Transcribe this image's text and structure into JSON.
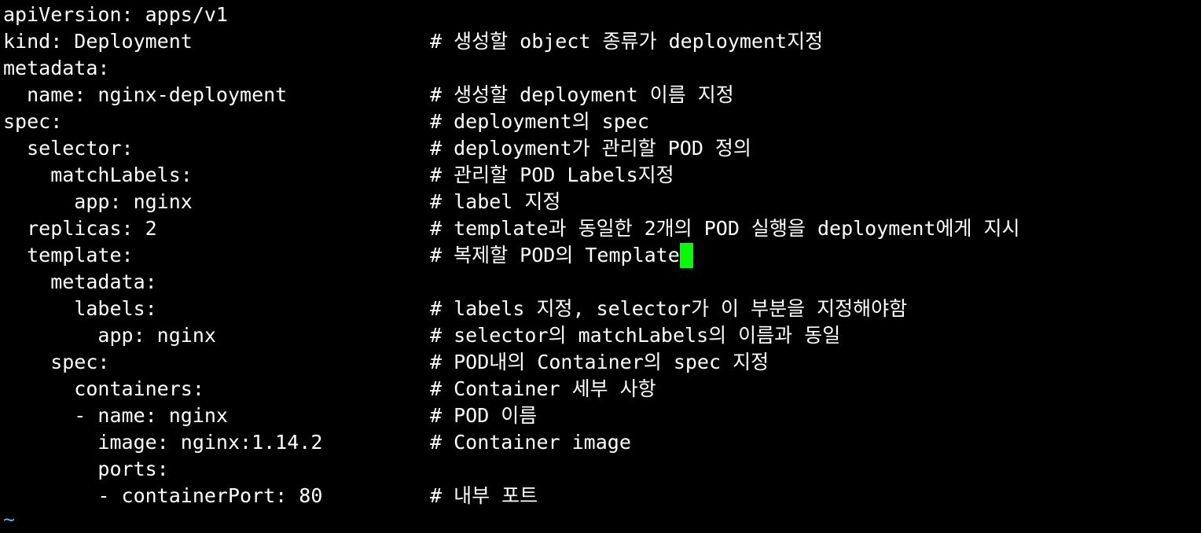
{
  "editor": {
    "lines": [
      {
        "code": "apiVersion: apps/v1",
        "comment": ""
      },
      {
        "code": "kind: Deployment",
        "comment": "# 생성할 object 종류가 deployment지정"
      },
      {
        "code": "metadata:",
        "comment": ""
      },
      {
        "code": "  name: nginx-deployment",
        "comment": "# 생성할 deployment 이름 지정"
      },
      {
        "code": "spec:",
        "comment": "# deployment의 spec"
      },
      {
        "code": "  selector:",
        "comment": "# deployment가 관리할 POD 정의"
      },
      {
        "code": "    matchLabels:",
        "comment": "# 관리할 POD Labels지정"
      },
      {
        "code": "      app: nginx",
        "comment": "# label 지정"
      },
      {
        "code": "  replicas: 2",
        "comment": "# template과 동일한 2개의 POD 실행을 deployment에게 지시"
      },
      {
        "code": "  template:",
        "comment": "# 복제할 POD의 Template"
      },
      {
        "code": "    metadata:",
        "comment": ""
      },
      {
        "code": "      labels:",
        "comment": "# labels 지정, selector가 이 부분을 지정해야함"
      },
      {
        "code": "        app: nginx",
        "comment": "# selector의 matchLabels의 이름과 동일"
      },
      {
        "code": "    spec:",
        "comment": "# POD내의 Container의 spec 지정"
      },
      {
        "code": "      containers:",
        "comment": "# Container 세부 사항"
      },
      {
        "code": "      - name: nginx",
        "comment": "# POD 이름"
      },
      {
        "code": "        image: nginx:1.14.2",
        "comment": "# Container image"
      },
      {
        "code": "        ports:",
        "comment": ""
      },
      {
        "code": "        - containerPort: 80",
        "comment": "# 내부 포트"
      }
    ],
    "empty_line_marker": "~",
    "cursor_line": 9
  },
  "colors": {
    "background": "#000000",
    "text": "#ffffff",
    "cursor": "#00ff00",
    "tilde": "#5fafff"
  }
}
